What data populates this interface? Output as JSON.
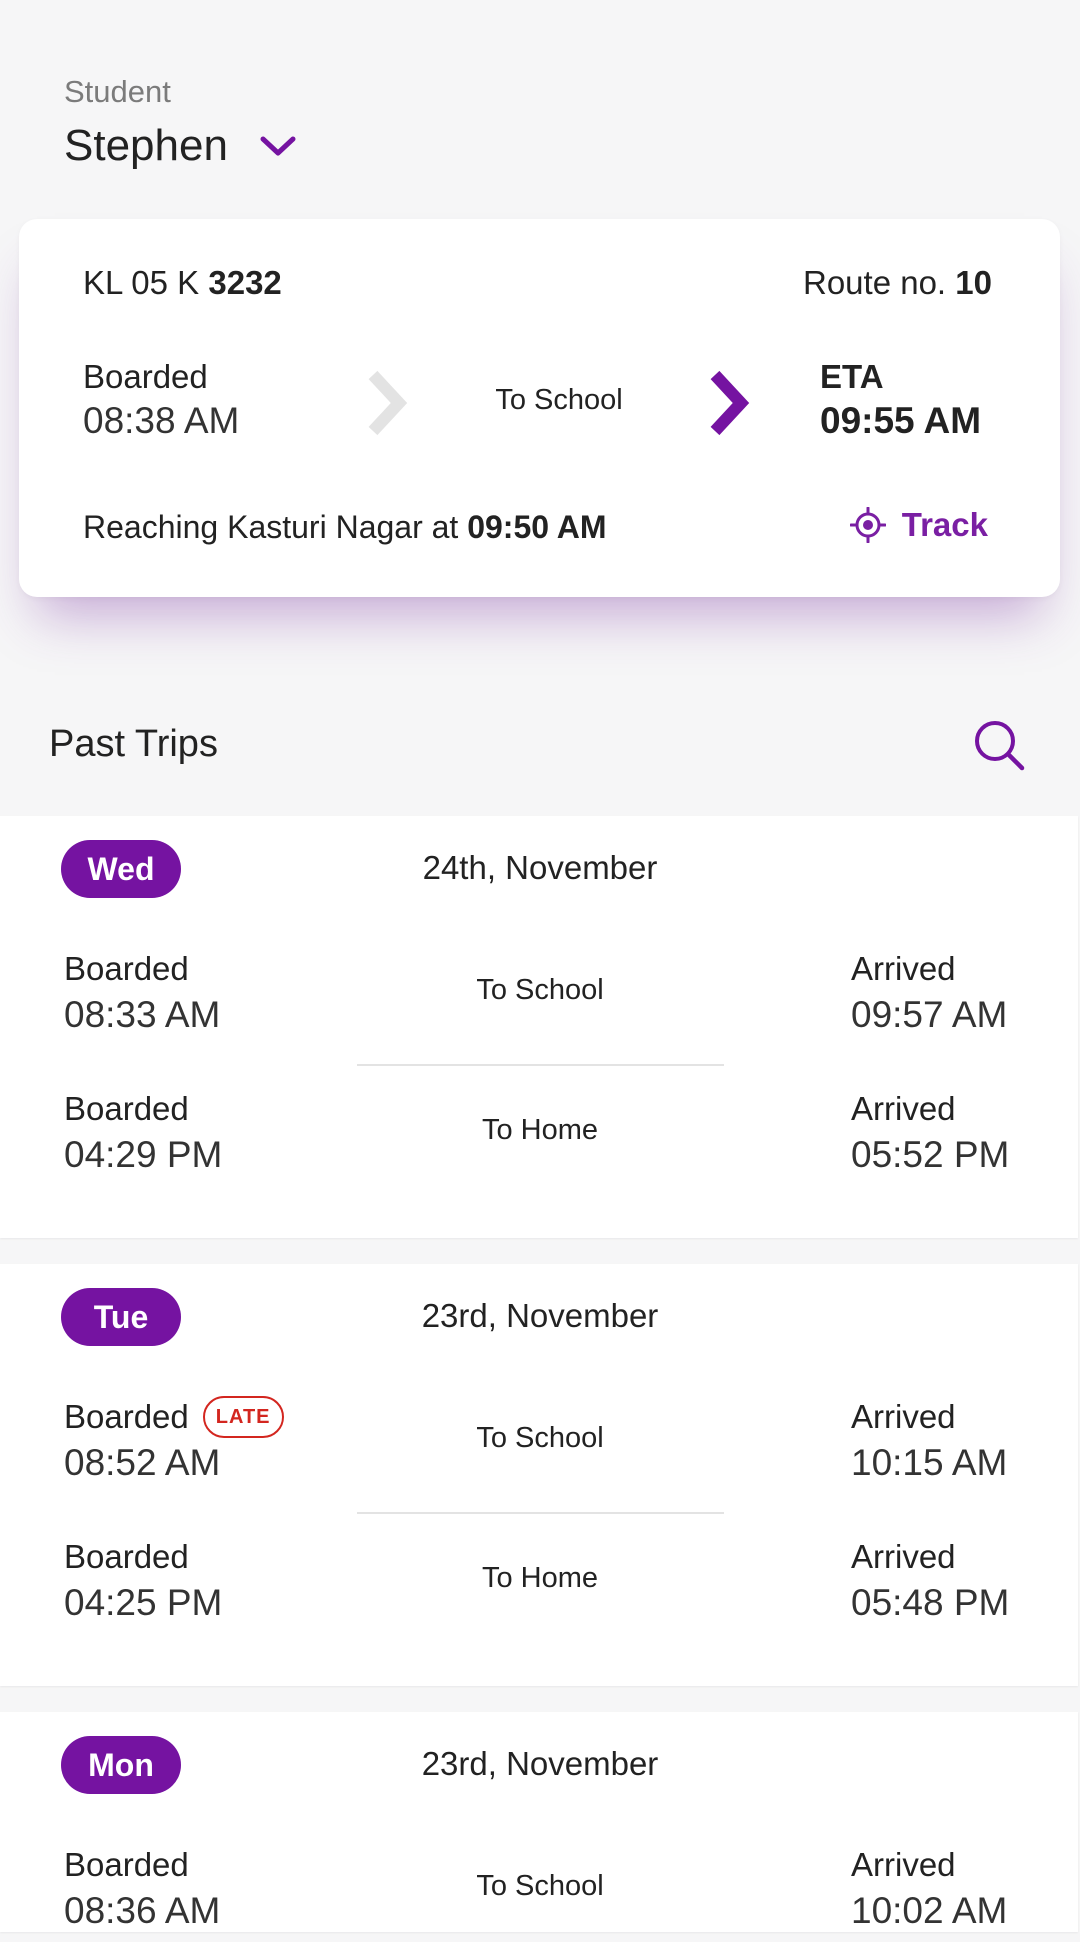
{
  "student": {
    "label": "Student",
    "name": "Stephen"
  },
  "active_trip": {
    "plate_prefix": "KL 05 K ",
    "plate_number": "3232",
    "route_label": "Route no. ",
    "route_number": "10",
    "boarded_label": "Boarded",
    "boarded_time": "08:38 AM",
    "direction": "To School",
    "eta_label": "ETA",
    "eta_time": "09:55 AM",
    "reaching_prefix": "Reaching Kasturi Nagar at ",
    "reaching_time": "09:50 AM",
    "track_label": "Track"
  },
  "past_trips": {
    "title": "Past Trips",
    "days": [
      {
        "day": "Wed",
        "date": "24th, November",
        "trips": [
          {
            "boarded_label": "Boarded",
            "boarded_time": "08:33 AM",
            "late": false,
            "direction": "To School",
            "arrived_label": "Arrived",
            "arrived_time": "09:57 AM"
          },
          {
            "boarded_label": "Boarded",
            "boarded_time": "04:29 PM",
            "late": false,
            "direction": "To Home",
            "arrived_label": "Arrived",
            "arrived_time": "05:52 PM"
          }
        ]
      },
      {
        "day": "Tue",
        "date": "23rd, November",
        "trips": [
          {
            "boarded_label": "Boarded",
            "boarded_time": "08:52 AM",
            "late": true,
            "late_label": "LATE",
            "direction": "To School",
            "arrived_label": "Arrived",
            "arrived_time": "10:15 AM"
          },
          {
            "boarded_label": "Boarded",
            "boarded_time": "04:25 PM",
            "late": false,
            "direction": "To Home",
            "arrived_label": "Arrived",
            "arrived_time": "05:48 PM"
          }
        ]
      },
      {
        "day": "Mon",
        "date": "23rd, November",
        "trips": [
          {
            "boarded_label": "Boarded",
            "boarded_time": "08:36 AM",
            "late": false,
            "direction": "To School",
            "arrived_label": "Arrived",
            "arrived_time": "10:02 AM"
          }
        ]
      }
    ]
  },
  "colors": {
    "accent": "#7513a1",
    "late": "#d3261f",
    "background": "#f6f6f7"
  }
}
